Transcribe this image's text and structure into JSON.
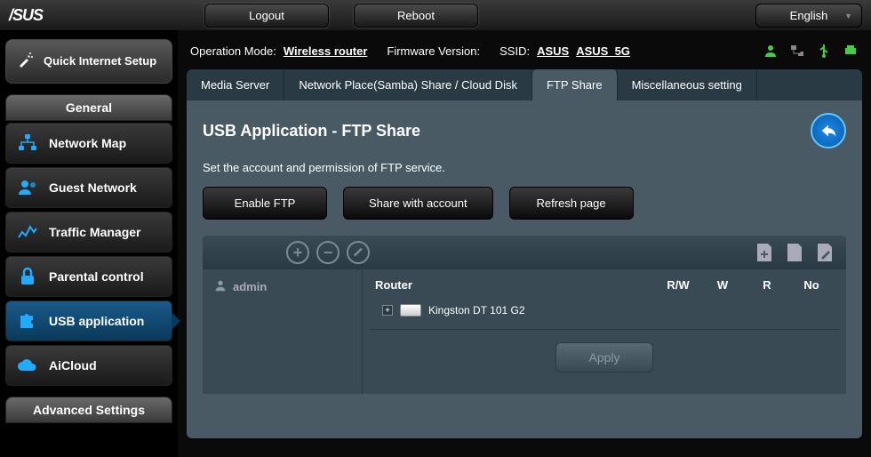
{
  "topbar": {
    "logout": "Logout",
    "reboot": "Reboot",
    "language": "English"
  },
  "quick_setup": {
    "label": "Quick Internet Setup"
  },
  "sidebar": {
    "section_general": "General",
    "section_advanced": "Advanced Settings",
    "items": [
      {
        "label": "Network Map"
      },
      {
        "label": "Guest Network"
      },
      {
        "label": "Traffic Manager"
      },
      {
        "label": "Parental control"
      },
      {
        "label": "USB application"
      },
      {
        "label": "AiCloud"
      }
    ]
  },
  "status": {
    "op_mode_label": "Operation Mode:",
    "op_mode_value": "Wireless  router",
    "fw_label": "Firmware Version:",
    "ssid_label": "SSID:",
    "ssid1": "ASUS",
    "ssid2": "ASUS_5G"
  },
  "tabs": [
    {
      "label": "Media Server"
    },
    {
      "label": "Network Place(Samba) Share / Cloud Disk"
    },
    {
      "label": "FTP Share"
    },
    {
      "label": "Miscellaneous setting"
    }
  ],
  "panel": {
    "title": "USB Application - FTP Share",
    "desc": "Set the account and permission of FTP service.",
    "enable_ftp": "Enable FTP",
    "share_account": "Share with account",
    "refresh": "Refresh page",
    "apply": "Apply"
  },
  "user": {
    "name": "admin"
  },
  "table": {
    "col_router": "Router",
    "col_rw": "R/W",
    "col_w": "W",
    "col_r": "R",
    "col_no": "No",
    "device": "Kingston DT 101 G2"
  }
}
